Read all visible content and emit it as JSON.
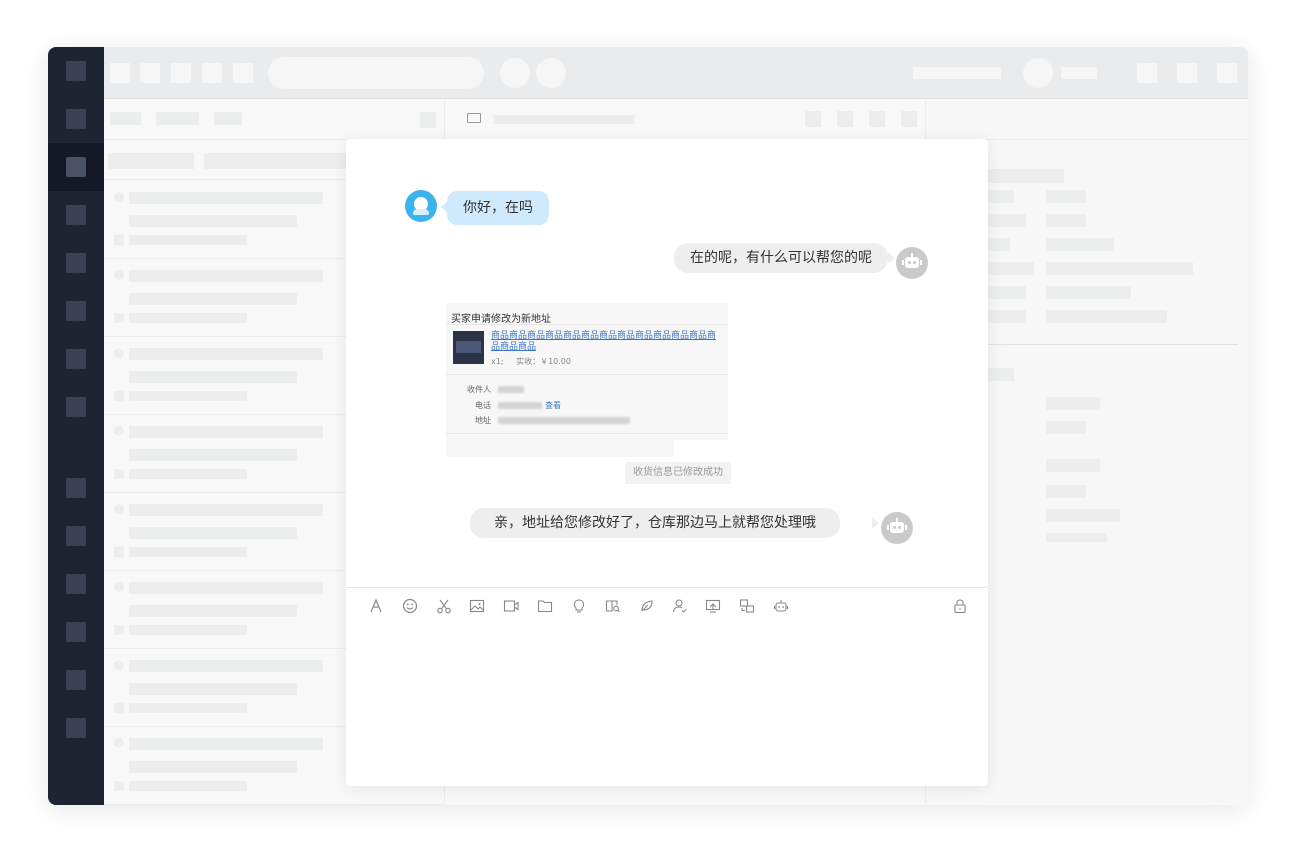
{
  "chat": {
    "messages": [
      {
        "role": "user",
        "text": "你好，在吗"
      },
      {
        "role": "bot",
        "text": "在的呢，有什么可以帮您的呢"
      },
      {
        "role": "bot",
        "text": "亲，地址给您修改好了，仓库那边马上就帮您处理哦"
      }
    ],
    "address_card": {
      "title": "买家申请修改为新地址",
      "product_name": "商品商品商品商品商品商品商品商品商品商品商品商品商品商品商品",
      "quantity": "x1;",
      "paid": "实收：￥10.00",
      "receiver_label": "收件人",
      "phone_label": "电话",
      "view_link": "查看",
      "address_label": "地址"
    },
    "system_notice": "收货信息已修改成功"
  },
  "toolbar": {
    "icons": [
      "font-icon",
      "emoji-icon",
      "scissors-icon",
      "image-icon",
      "video-icon",
      "folder-icon",
      "bulb-icon",
      "book-search-icon",
      "leaf-icon",
      "user-check-icon",
      "screen-share-icon",
      "transfer-icon",
      "robot-icon"
    ],
    "lock_icon": "lock-icon"
  },
  "colors": {
    "sidebar": "#1f2433",
    "user_bubble": "#cfe9fd",
    "bot_bubble": "#eeeeef",
    "link": "#3a76c4",
    "user_avatar": "#3db3ee"
  }
}
